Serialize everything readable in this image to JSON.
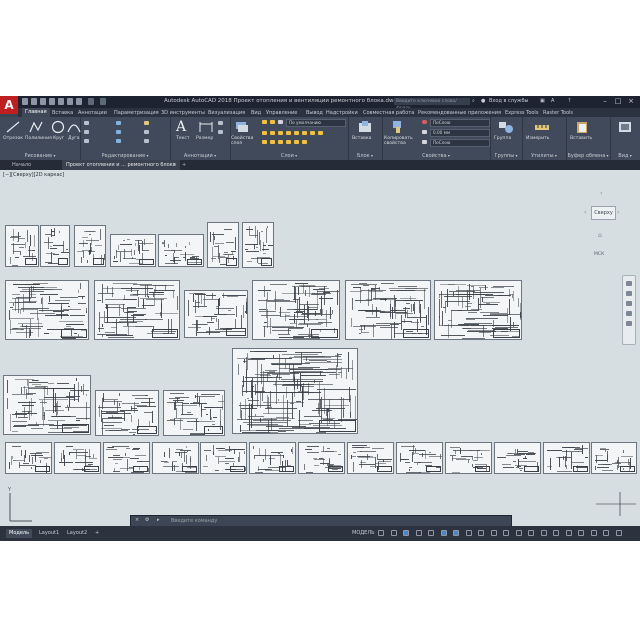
{
  "titlebar": {
    "logo": "A",
    "title": "Autodesk AutoCAD 2018   Проект отопления и вентиляции ремонтного блока.dwg",
    "search_placeholder": "Введите ключевое слово/фразу",
    "user": "Вход в службы",
    "help": "?"
  },
  "ribbon_tabs": [
    "Главная",
    "Вставка",
    "Аннотации",
    "Параметризация",
    "3D инструменты",
    "Визуализация",
    "Вид",
    "Управление",
    "Вывод",
    "Надстройки",
    "Совместная работа",
    "Рекомендованные приложения",
    "Express Tools",
    "Raster Tools"
  ],
  "ribbon": {
    "draw": {
      "line": "Отрезок",
      "polyline": "Полилиния",
      "circle": "Круг",
      "arc": "Дуга",
      "label": "Рисование"
    },
    "modify": {
      "label": "Редактирование"
    },
    "annotation": {
      "text": "Текст",
      "size": "Размер",
      "label": "Аннотации"
    },
    "layers": {
      "props": "Свойства слоя",
      "current_layer": "По умолчанию",
      "label": "Слои"
    },
    "block": {
      "insert": "Вставка",
      "label": "Блок"
    },
    "properties": {
      "match": "Копировать свойства",
      "bylayer1": "ПоСлою",
      "lw": "0.00 мм",
      "bylayer2": "ПоСлою",
      "label": "Свойства"
    },
    "groups": {
      "group": "Группа",
      "label": "Группы"
    },
    "utilities": {
      "measure": "Измерить",
      "label": "Утилиты"
    },
    "clipboard": {
      "paste": "Вставить",
      "label": "Буфер обмена"
    },
    "view": {
      "label": "Вид"
    }
  },
  "doc_tabs": {
    "start": "Начало",
    "drawing": "Проект отопления и ... ремонтного блока",
    "close": "×",
    "add": "+"
  },
  "viewport": {
    "label": "[−][Сверху][2D каркас]",
    "viewcube_face": "Сверху",
    "wcs": "МСК"
  },
  "command_line": {
    "placeholder": "Введите команду"
  },
  "status": {
    "tabs": [
      "Модель",
      "Layout1",
      "Layout2"
    ],
    "add": "+",
    "model": "МОДЕЛЬ"
  }
}
